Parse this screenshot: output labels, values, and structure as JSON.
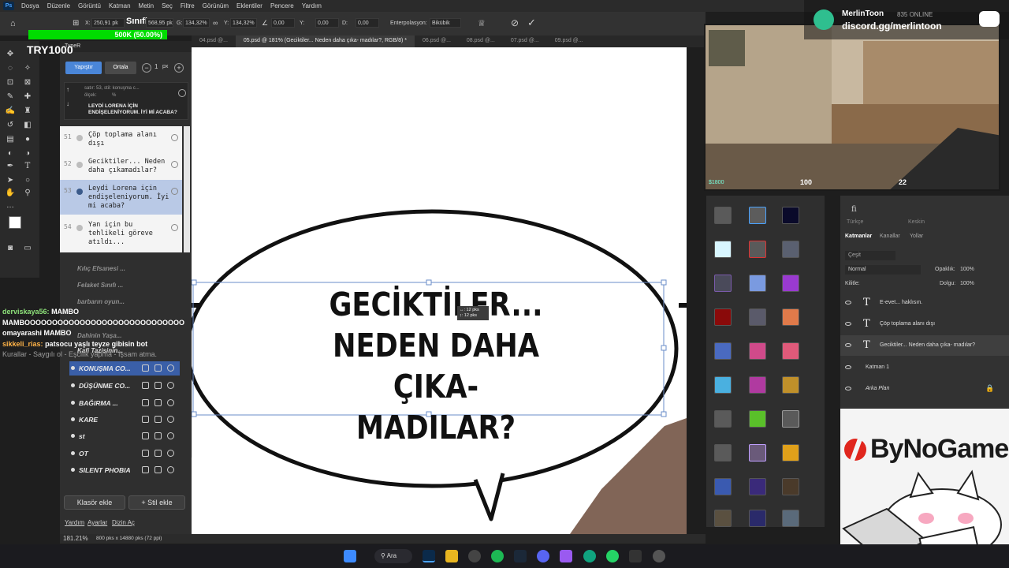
{
  "menu": {
    "app_icon": "Ps",
    "items": [
      "Dosya",
      "Düzenle",
      "Görüntü",
      "Katman",
      "Metin",
      "Seç",
      "Filtre",
      "Görünüm",
      "Eklentiler",
      "Pencere",
      "Yardım"
    ]
  },
  "options": {
    "x_label": "X:",
    "x_value": "250,91 pk",
    "y_value": "568,95 pk",
    "w_label": "G:",
    "w_value": "134,32%",
    "h_label": "Y:",
    "h_value": "134,32%",
    "angle_value": "0,00",
    "h2_label": "Y:",
    "h2_value": "0,00",
    "v_label": "D:",
    "v_value": "0,00",
    "interp_label": "Enterpolasyon:",
    "interp_value": "Bikübik",
    "overlay": "Sınıflar"
  },
  "progress": {
    "text": "500K (50.00%)",
    "percent": 50
  },
  "watermark": "TRY1000",
  "tabs": [
    {
      "label": "04.psd @..."
    },
    {
      "label": "05.psd @ 181% (Geciktiler... Neden daha çıka- madılar?, RGB/8) *",
      "active": true
    },
    {
      "label": "06.psd @..."
    },
    {
      "label": "08.psd @..."
    },
    {
      "label": "07.psd @..."
    },
    {
      "label": "09.psd @..."
    }
  ],
  "typer": {
    "title": "TypeR",
    "btn_primary": "Yapıştır",
    "btn_secondary": "Ortala",
    "size_value": "1",
    "size_unit": "px",
    "preview_meta": "satır: 53, stil: konuşma c...",
    "preview_scale": "ölçek:",
    "preview_pct": "%",
    "preview_text": "LEYDİ LORENA İÇİN ENDİŞELENİYORUM. İYİ Mİ ACABA?",
    "lines": [
      {
        "num": "51",
        "text": "Çöp toplama alanı dışı"
      },
      {
        "num": "52",
        "text": "Geciktiler... Neden daha çıkamadılar?"
      },
      {
        "num": "53",
        "text": "Leydi Lorena için endişeleniyorum. İyi mi acaba?",
        "selected": true
      },
      {
        "num": "54",
        "text": "Yan için bu tehlikeli göreve atıldı..."
      }
    ],
    "presets": [
      "Kılıç Efsanesi ...",
      "Felaket Sınıfı ...",
      "barbarın oyun...",
      "Dahinin Yaşa...",
      "Kafi Tazisinin..."
    ],
    "styles": [
      "KONUŞMA CO...",
      "DÜŞÜNME CO...",
      "BAĞIRMA ...",
      "KARE",
      "st",
      "OT",
      "SILENT PHOBIA"
    ],
    "add_folder": "Klasör ekle",
    "add_style": "+ Stil ekle",
    "footer": [
      "Yardım",
      "Ayarlar",
      "Dizin Aç"
    ]
  },
  "canvas": {
    "bubble_lines": [
      "GECİKTİLER...",
      "NEDEN DAHA ÇIKA-",
      "MADILAR?"
    ],
    "measure": [
      "↔: 12 pks",
      "↕: 12 pks"
    ]
  },
  "chat": [
    {
      "user": "derviskaya56:",
      "msg": "MAMBO",
      "color": "#8ee27a"
    },
    {
      "user": "",
      "msg": "MAMBOOOOOOOOOOOOOOOOOOOOOOOOOOOOO",
      "color": "#ffffff"
    },
    {
      "user": "omayarashi",
      "msg": "MAMBO",
      "color": "#ffffff"
    },
    {
      "user": "sikkeli_rias:",
      "msg": "patsocu yaşlı teyze gibisin bot",
      "color": "#ffb347"
    },
    {
      "user": "",
      "msg": "Kurallar - Saygılı ol - Eşcilik yapma - İşsam atma.",
      "color": "#9e9e9e"
    }
  ],
  "status": {
    "zoom": "181.21%",
    "doc": "800 pks x 14880 pks (72 ppi)"
  },
  "stream": {
    "name": "MerlinToon",
    "online": "835 ONLINE",
    "discord": "discord.gg/merlintoon",
    "hud_hp": "100",
    "hud_ammo": "22",
    "hud_money": "$1800"
  },
  "layers_panel": {
    "tabs": [
      "Katmanlar",
      "Kanallar",
      "Yollar"
    ],
    "search": "Çeşit",
    "blend": "Normal",
    "opacity_label": "Opaklık:",
    "opacity": "100%",
    "fill_label": "Dolgu:",
    "fill": "100%",
    "lock_label": "Kilitle:",
    "font_lang": "Türkçe",
    "aa": "Keskin",
    "layers": [
      {
        "name": "E-evet... haklısın.",
        "type": "text"
      },
      {
        "name": "Çöp toplama alanı dışı",
        "type": "text"
      },
      {
        "name": "Geciktiler... Neden daha çıka- madılar?",
        "type": "text",
        "selected": true
      },
      {
        "name": "Katman 1",
        "type": "pixel"
      },
      {
        "name": "Arka Plan",
        "type": "pixel",
        "locked": true
      }
    ]
  },
  "sponsor": "ByNoGame",
  "taskbar": {
    "search": "Ara"
  },
  "colors": {
    "ps_blue": "#31a8ff",
    "accent": "#3a5fa8",
    "progress": "#00dd00"
  }
}
